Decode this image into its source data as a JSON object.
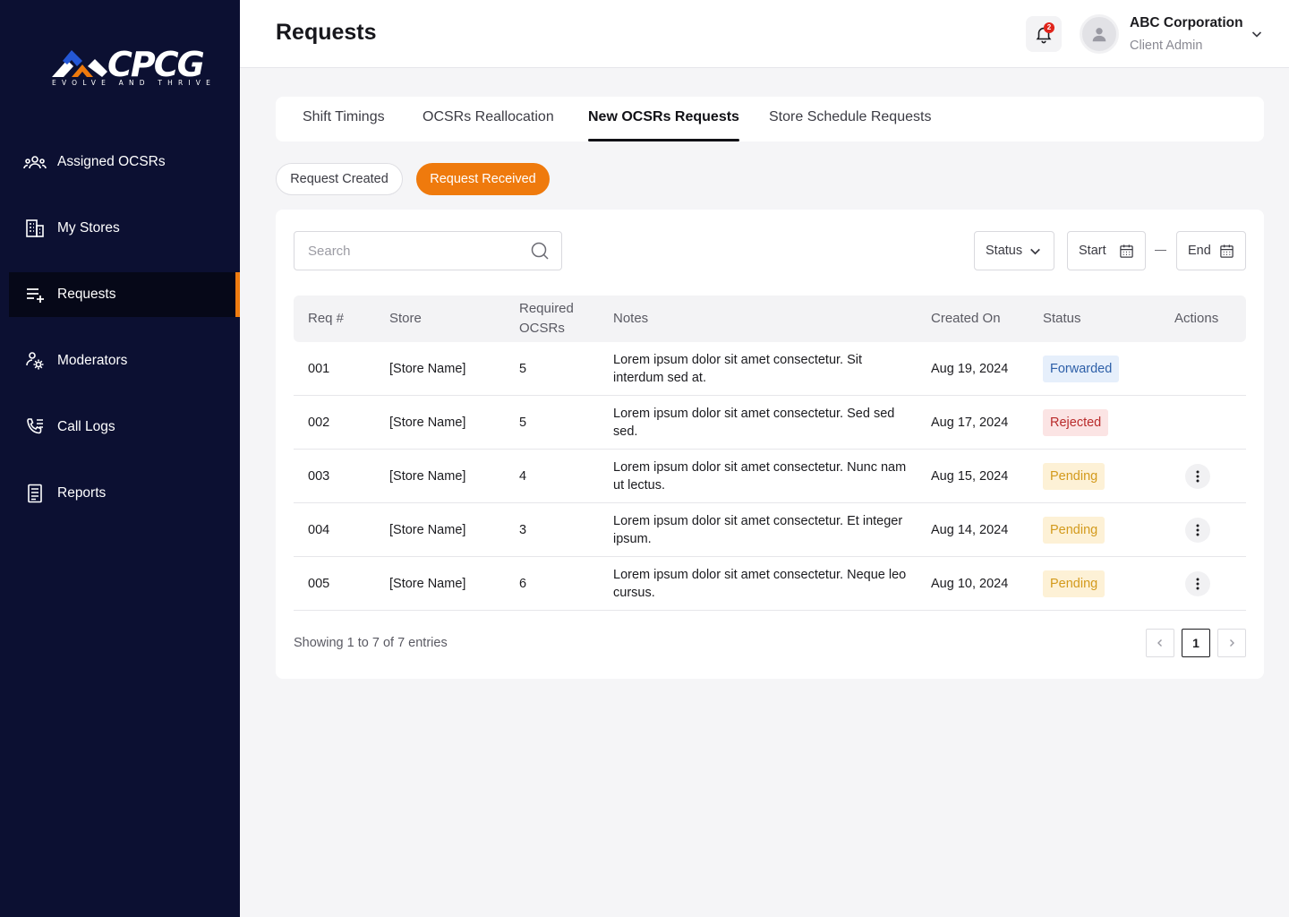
{
  "brand": {
    "logo_text": "CPCG",
    "tagline": "EVOLVE AND THRIVE",
    "colors": {
      "sidebar": "#0c1032",
      "accent": "#ef7a0d"
    }
  },
  "sidebar": {
    "items": [
      {
        "label": "Assigned OCSRs",
        "icon": "users-group-icon"
      },
      {
        "label": "My Stores",
        "icon": "building-icon"
      },
      {
        "label": "Requests",
        "icon": "list-add-icon",
        "active": true
      },
      {
        "label": "Moderators",
        "icon": "user-gear-icon"
      },
      {
        "label": "Call Logs",
        "icon": "phone-list-icon"
      },
      {
        "label": "Reports",
        "icon": "document-icon"
      }
    ]
  },
  "header": {
    "title": "Requests",
    "notification_count": "2",
    "user": {
      "name": "ABC Corporation",
      "role": "Client Admin"
    }
  },
  "tabs": [
    {
      "label": "Shift Timings"
    },
    {
      "label": "OCSRs Reallocation"
    },
    {
      "label": "New OCSRs Requests",
      "active": true
    },
    {
      "label": "Store Schedule Requests"
    }
  ],
  "subtabs": {
    "created": "Request Created",
    "received": "Request Received",
    "active": "received"
  },
  "filters": {
    "search_placeholder": "Search",
    "status": "Status",
    "start": "Start",
    "end": "End"
  },
  "table": {
    "columns": {
      "req": "Req #",
      "store": "Store",
      "required_1": "Required",
      "required_2": "OCSRs",
      "notes": "Notes",
      "created": "Created On",
      "status": "Status",
      "actions": "Actions"
    },
    "rows": [
      {
        "req": "001",
        "store": "[Store Name]",
        "required": "5",
        "notes": "Lorem ipsum dolor sit amet consectetur. Sit interdum sed at.",
        "created": "Aug 19, 2024",
        "status": "Forwarded",
        "has_actions": false
      },
      {
        "req": "002",
        "store": "[Store Name]",
        "required": "5",
        "notes": "Lorem ipsum dolor sit amet consectetur. Sed sed sed.",
        "created": "Aug 17, 2024",
        "status": "Rejected",
        "has_actions": false
      },
      {
        "req": "003",
        "store": "[Store Name]",
        "required": "4",
        "notes": "Lorem ipsum dolor sit amet consectetur. Nunc nam ut lectus.",
        "created": "Aug 15, 2024",
        "status": "Pending",
        "has_actions": true
      },
      {
        "req": "004",
        "store": "[Store Name]",
        "required": "3",
        "notes": "Lorem ipsum dolor sit amet consectetur. Et integer ipsum.",
        "created": "Aug 14, 2024",
        "status": "Pending",
        "has_actions": true
      },
      {
        "req": "005",
        "store": "[Store Name]",
        "required": "6",
        "notes": "Lorem ipsum dolor sit amet consectetur. Neque leo cursus.",
        "created": "Aug 10, 2024",
        "status": "Pending",
        "has_actions": true
      }
    ],
    "status_colors": {
      "Forwarded": {
        "bg": "#e6effb",
        "fg": "#2d5fa8"
      },
      "Rejected": {
        "bg": "#fbe4e4",
        "fg": "#b92b2b"
      },
      "Pending": {
        "bg": "#fdf1d6",
        "fg": "#d39a1c"
      }
    }
  },
  "pagination": {
    "summary": "Showing 1 to 7 of 7 entries",
    "current_page": "1"
  }
}
